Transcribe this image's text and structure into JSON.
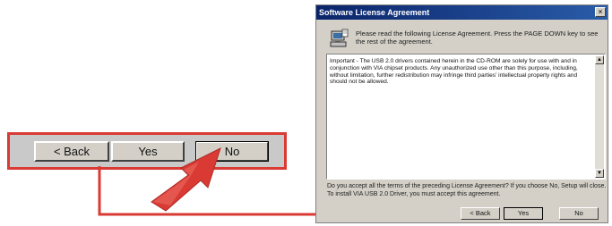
{
  "zoom": {
    "back_label": "< Back",
    "yes_label": "Yes",
    "no_label": "No"
  },
  "dialog": {
    "title": "Software License Agreement",
    "close_glyph": "×",
    "prompt": "Please read the following License Agreement.  Press the PAGE DOWN key to see the rest of the agreement.",
    "license_text": "Important - The USB 2.0 drivers contained herein in the CD-ROM are solely for use with and in conjunction with VIA chipset products. Any unauthorized use other than this purpose, including, without limitation, further redistribution may infringe third parties' intellectual property rights and should not be allowed.",
    "question": "Do you accept all the terms of the preceding License Agreement?  If you choose No, Setup will close.  To install VIA USB 2.0 Driver, you must accept this agreement.",
    "buttons": {
      "back_label": "< Back",
      "yes_label": "Yes",
      "no_label": "No"
    },
    "scroll_up_glyph": "▲",
    "scroll_down_glyph": "▼"
  },
  "colors": {
    "highlight_red": "#d93a34",
    "titlebar_blue": "#0a246a",
    "window_gray": "#d4d0c8"
  },
  "icons": {
    "setup_icon": "computer-setup-icon",
    "pointer": "red-pointer-arrow-icon",
    "connector": "connector-arrow-icon"
  }
}
